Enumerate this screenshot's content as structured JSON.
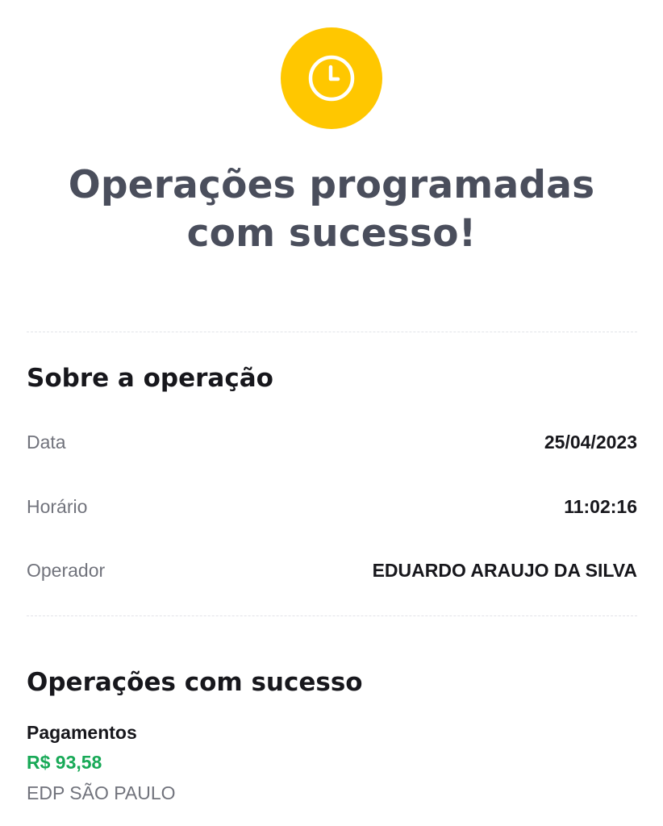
{
  "status": {
    "icon": "clock-icon",
    "accent_color": "#ffc700"
  },
  "headline": {
    "line1": "Operações programadas",
    "line2": "com sucesso!"
  },
  "about": {
    "title": "Sobre a operação",
    "date_label": "Data",
    "date_value": "25/04/2023",
    "time_label": "Horário",
    "time_value": "11:02:16",
    "operator_label": "Operador",
    "operator_value": "EDUARDO ARAUJO DA SILVA"
  },
  "success": {
    "title": "Operações com sucesso",
    "items": [
      {
        "type": "Pagamentos",
        "amount": "R$ 93,58",
        "amount_color": "#18a957",
        "payee": "EDP SÃO PAULO"
      }
    ]
  }
}
